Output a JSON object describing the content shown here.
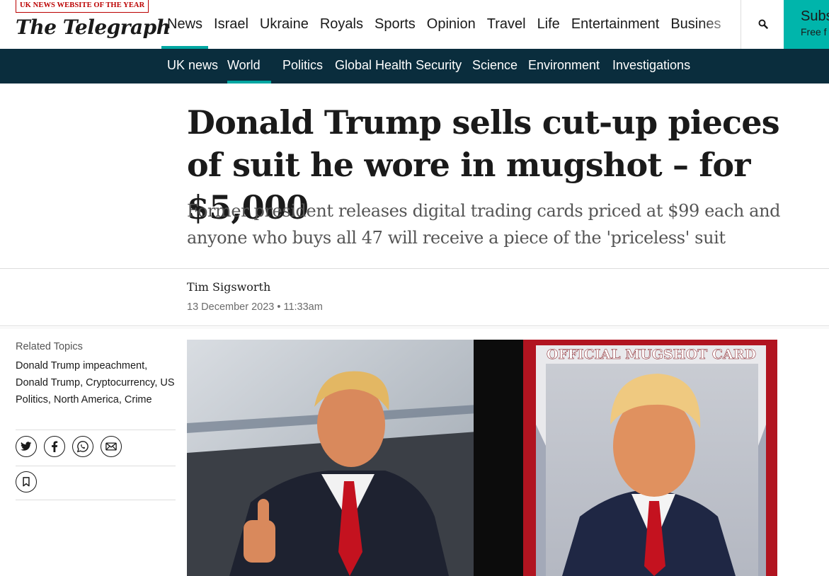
{
  "header": {
    "badge": "UK NEWS WEBSITE OF THE YEAR",
    "logo": "The Telegraph",
    "nav": [
      "News",
      "Israel",
      "Ukraine",
      "Royals",
      "Sports",
      "Opinion",
      "Travel",
      "Life",
      "Entertainment",
      "Busines"
    ],
    "active_nav": "News",
    "search_icon": "search-icon",
    "subscribe": {
      "title": "Subs",
      "subtitle": "Free f"
    },
    "accent_color": "#00a7a2",
    "subscribe_color": "#00b5ab"
  },
  "subnav": {
    "items": [
      "UK news",
      "World",
      "Politics",
      "Global Health Security",
      "Science",
      "Environment",
      "Investigations"
    ],
    "active": "World",
    "background": "#0a2d3d"
  },
  "article": {
    "headline": "Donald Trump sells cut-up pieces of suit he wore in mugshot – for $5,000",
    "standfirst": "Former president releases digital trading cards priced at $99 each and anyone who buys all 47 will receive a piece of the 'priceless' suit",
    "author": "Tim Sigsworth",
    "date": "13 December 2023 • 11:33am"
  },
  "sidebar": {
    "related_label": "Related Topics",
    "topics_text": "Donald Trump impeachment, Donald Trump, Cryptocurrency, US Politics, North America, Crime",
    "share_icons": [
      "twitter-icon",
      "facebook-icon",
      "whatsapp-icon",
      "email-icon"
    ],
    "bookmark_icon": "bookmark-icon"
  },
  "image": {
    "card_caption": "OFFICIAL MUGSHOT CARD"
  }
}
